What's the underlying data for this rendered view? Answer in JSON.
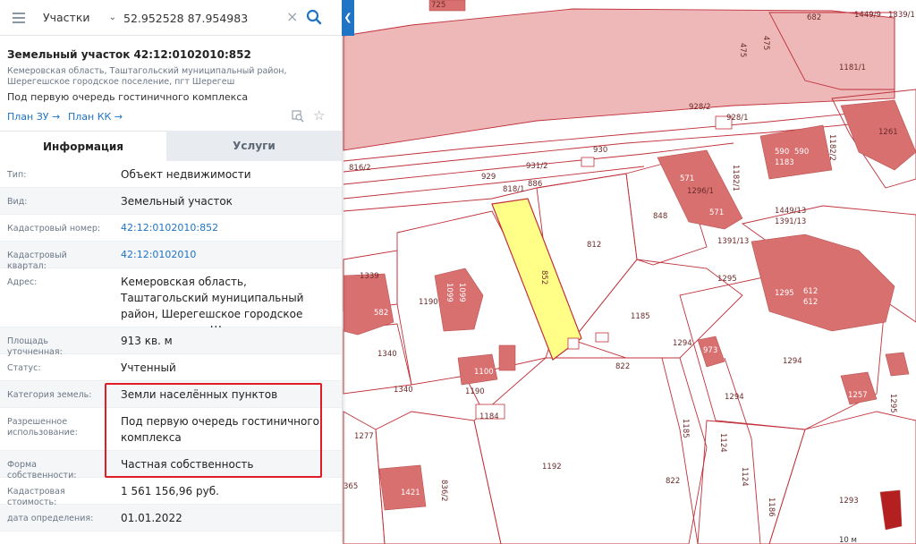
{
  "search": {
    "layer": "Участки",
    "coords": "52.952528 87.954983"
  },
  "object": {
    "title": "Земельный участок 42:12:0102010:852",
    "address": "Кемеровская область, Таштагольский муниципальный район, Шерегешское городское поселение, пгт Шерегеш",
    "purpose": "Под первую очередь гостиничного комплекса",
    "links": [
      "План ЗУ →",
      "План КК →"
    ]
  },
  "tabs": [
    {
      "label": "Информация",
      "active": true
    },
    {
      "label": "Услуги",
      "active": false
    }
  ],
  "rows": [
    {
      "label": "Тип:",
      "value": "Объект недвижимости"
    },
    {
      "label": "Вид:",
      "value": "Земельный участок"
    },
    {
      "label": "Кадастровый номер:",
      "value": "42:12:0102010:852",
      "link": true
    },
    {
      "label": "Кадастровый квартал:",
      "value": "42:12:0102010",
      "link": true
    },
    {
      "label": "Адрес:",
      "value": "Кемеровская область, Таштагольский муниципальный район, Шерегешское городское поселение, пгт Шерегеш"
    },
    {
      "label": "Площадь уточненная:",
      "value": "913 кв. м"
    },
    {
      "label": "Статус:",
      "value": "Учтенный"
    },
    {
      "label": "Категория земель:",
      "value": "Земли населённых пунктов"
    },
    {
      "label": "Разрешенное использование:",
      "value": "Под первую очередь гостиничного комплекса"
    },
    {
      "label": "Форма собственности:",
      "value": "Частная собственность"
    },
    {
      "label": "Кадастровая стоимость:",
      "value": "1 561 156,96 руб."
    },
    {
      "label": "дата определения:",
      "value": "01.01.2022"
    }
  ],
  "map_labels": [
    "725",
    "682",
    "1449/9",
    "1339/1",
    "475",
    "475",
    "1181/1",
    "928/2",
    "928/1",
    "1182/2",
    "1261",
    "930",
    "816/2",
    "931/2",
    "929",
    "818/1",
    "886",
    "571",
    "1296/1",
    "1182/1",
    "590",
    "590",
    "1183",
    "571",
    "1449/13",
    "1391/13",
    "848",
    "812",
    "852",
    "1391/13",
    "1339",
    "582",
    "1190",
    "1099",
    "1099",
    "1295",
    "1295",
    "612",
    "612",
    "1185",
    "1340",
    "1100",
    "1294",
    "973",
    "1294",
    "1190",
    "822",
    "1340",
    "1184",
    "1294",
    "1295",
    "1257",
    "1277",
    "1185",
    "1124",
    "1192",
    "365",
    "1421",
    "836/2",
    "822",
    "1124",
    "1186",
    "1293",
    "10 м"
  ],
  "colors": {
    "accent": "#1f74c5",
    "highlight": "#e01c24",
    "parcel_selected": "#ffff88",
    "building": "#d97070",
    "area_fill": "#eeb8b8",
    "boundary": "#c0303a"
  }
}
